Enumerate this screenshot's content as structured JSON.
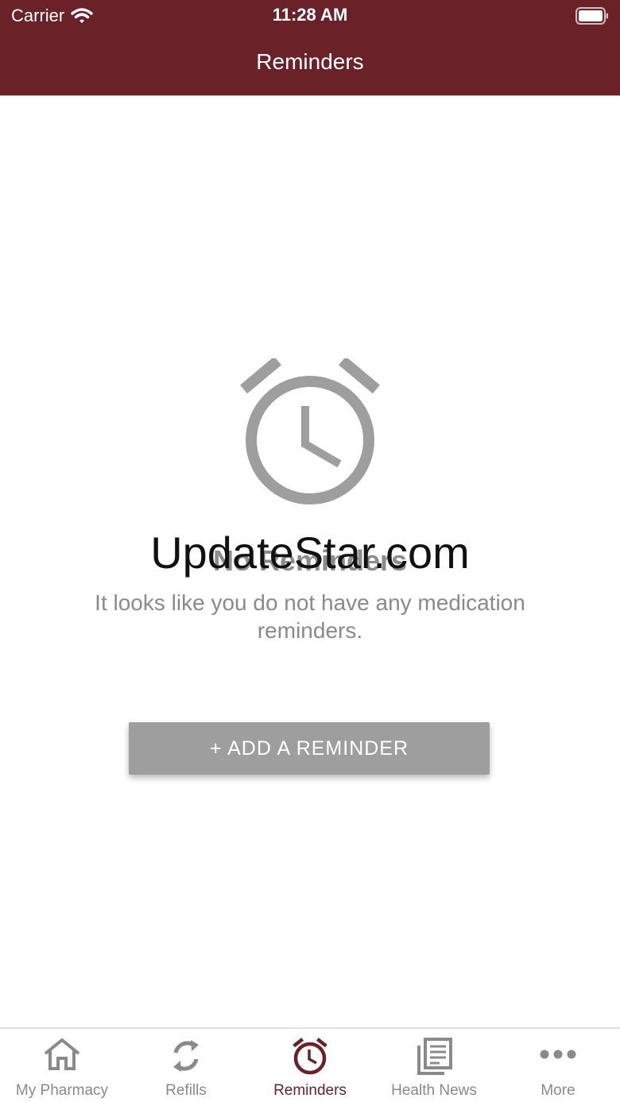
{
  "status_bar": {
    "carrier": "Carrier",
    "time": "11:28 AM"
  },
  "header": {
    "title": "Reminders"
  },
  "empty_state": {
    "title": "No Reminders",
    "message": "It looks like you do not have any medication reminders.",
    "add_button_label": "+ ADD A REMINDER",
    "watermark": "UpdateStar.com"
  },
  "tabs": [
    {
      "label": "My Pharmacy",
      "icon": "home-icon",
      "active": false
    },
    {
      "label": "Refills",
      "icon": "refresh-icon",
      "active": false
    },
    {
      "label": "Reminders",
      "icon": "alarm-clock-icon",
      "active": true
    },
    {
      "label": "Health News",
      "icon": "news-icon",
      "active": false
    },
    {
      "label": "More",
      "icon": "more-icon",
      "active": false
    }
  ],
  "colors": {
    "brand": "#6b2128",
    "inactive": "#8a8a8a",
    "button": "#9e9e9e"
  }
}
